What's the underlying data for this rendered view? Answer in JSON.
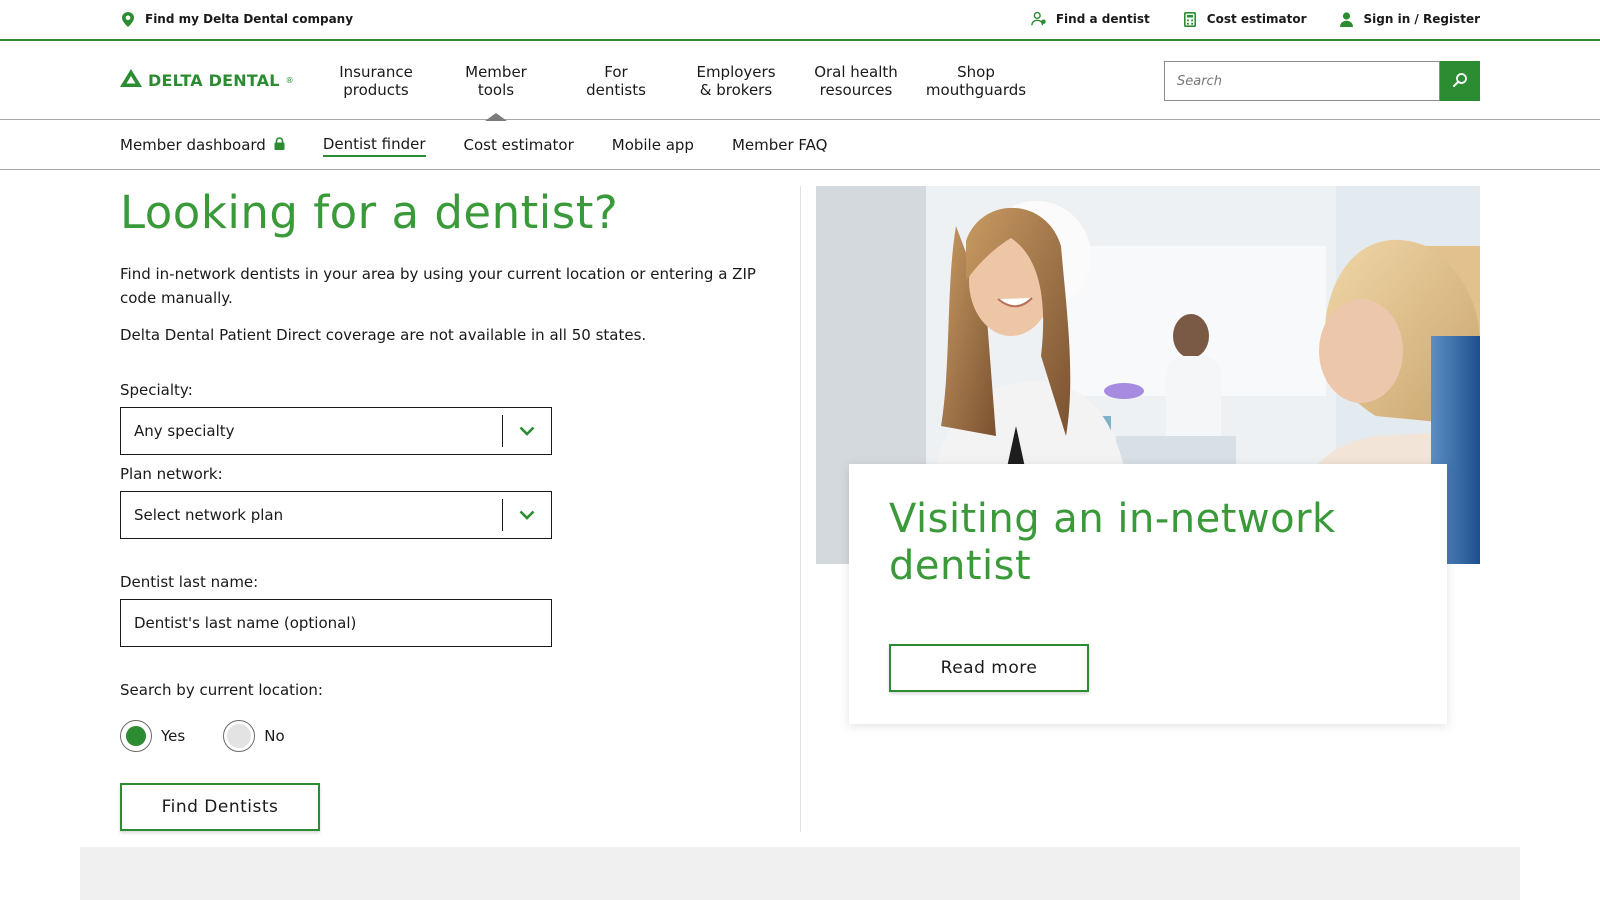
{
  "utility": {
    "find_company": "Find my Delta Dental company",
    "find_dentist": "Find a dentist",
    "cost_estimator": "Cost estimator",
    "sign_in": "Sign in / Register"
  },
  "logo": {
    "text": "DELTA DENTAL",
    "reg": "®"
  },
  "nav": {
    "items": [
      {
        "label": "Insurance\nproducts"
      },
      {
        "label": "Member\ntools"
      },
      {
        "label": "For\ndentists"
      },
      {
        "label": "Employers\n& brokers"
      },
      {
        "label": "Oral health\nresources"
      },
      {
        "label": "Shop\nmouthguards"
      }
    ],
    "search_placeholder": "Search"
  },
  "subnav": {
    "items": [
      {
        "label": "Member dashboard"
      },
      {
        "label": "Dentist finder"
      },
      {
        "label": "Cost estimator"
      },
      {
        "label": "Mobile app"
      },
      {
        "label": "Member FAQ"
      }
    ]
  },
  "main": {
    "title": "Looking for a dentist?",
    "intro": "Find in-network dentists in your area by using your current location or entering a ZIP code manually.",
    "note": "Delta Dental Patient Direct coverage are not available in all 50 states.",
    "specialty_label": "Specialty:",
    "specialty_value": "Any specialty",
    "plan_label": "Plan network:",
    "plan_value": "Select network plan",
    "lastname_label": "Dentist last name:",
    "lastname_placeholder": "Dentist's last name (optional)",
    "location_label": "Search by current location:",
    "radio_yes": "Yes",
    "radio_no": "No",
    "find_button": "Find Dentists"
  },
  "card": {
    "title": "Visiting an in-network dentist",
    "button": "Read more"
  },
  "colors": {
    "brand_green": "#2c8c32",
    "heading_green": "#3a9a3a"
  }
}
